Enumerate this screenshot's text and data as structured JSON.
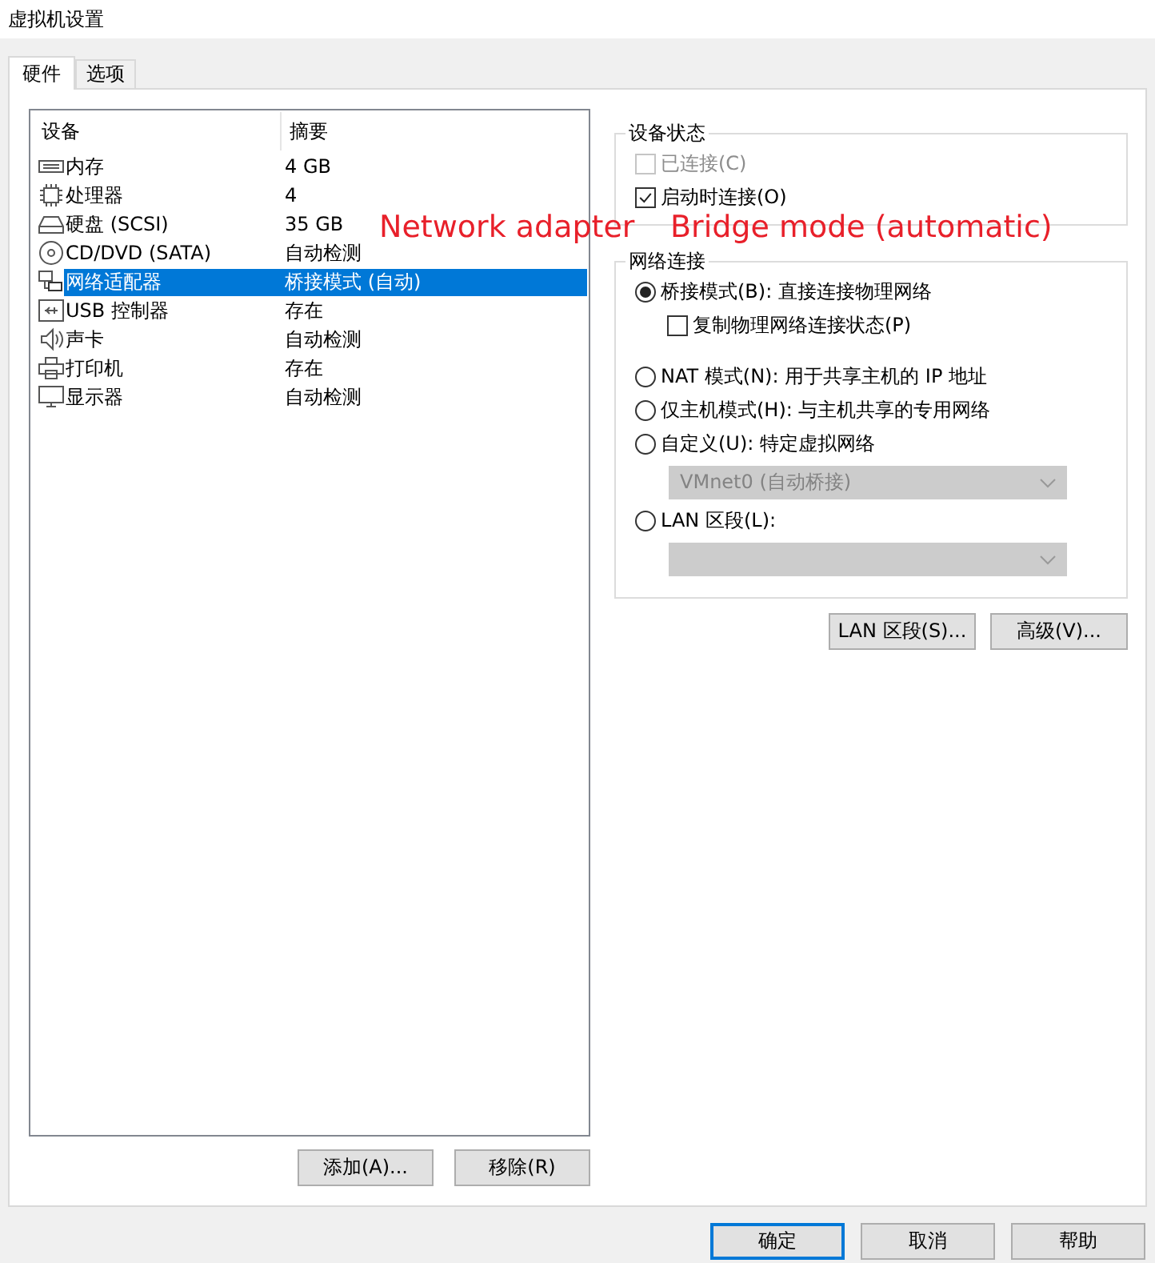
{
  "window": {
    "title": "虚拟机设置"
  },
  "tabs": [
    {
      "label": "硬件",
      "selected": true
    },
    {
      "label": "选项",
      "selected": false
    }
  ],
  "device_list": {
    "columns": [
      "设备",
      "摘要"
    ],
    "rows": [
      {
        "kind": "memory",
        "device": "内存",
        "summary": "4 GB",
        "selected": false
      },
      {
        "kind": "cpu",
        "device": "处理器",
        "summary": "4",
        "selected": false
      },
      {
        "kind": "disk",
        "device": "硬盘 (SCSI)",
        "summary": "35 GB",
        "selected": false
      },
      {
        "kind": "cd",
        "device": "CD/DVD (SATA)",
        "summary": "自动检测",
        "selected": false
      },
      {
        "kind": "network",
        "device": "网络适配器",
        "summary": "桥接模式 (自动)",
        "selected": true
      },
      {
        "kind": "usb",
        "device": "USB 控制器",
        "summary": "存在",
        "selected": false
      },
      {
        "kind": "sound",
        "device": "声卡",
        "summary": "自动检测",
        "selected": false
      },
      {
        "kind": "printer",
        "device": "打印机",
        "summary": "存在",
        "selected": false
      },
      {
        "kind": "display",
        "device": "显示器",
        "summary": "自动检测",
        "selected": false
      }
    ]
  },
  "list_buttons": [
    "添加(A)...",
    "移除(R)"
  ],
  "device_status": {
    "title": "设备状态",
    "options": [
      {
        "label": "已连接(C)",
        "checked": false,
        "disabled": true
      },
      {
        "label": "启动时连接(O)",
        "checked": true,
        "disabled": false
      }
    ]
  },
  "network_connection": {
    "title": "网络连接",
    "items": [
      {
        "kind": "radio",
        "label": "桥接模式(B): 直接连接物理网络",
        "selected": true
      },
      {
        "kind": "checkbox",
        "label": "复制物理网络连接状态(P)",
        "checked": false
      },
      {
        "kind": "radio",
        "label": "NAT 模式(N): 用于共享主机的 IP 地址",
        "selected": false
      },
      {
        "kind": "radio",
        "label": "仅主机模式(H): 与主机共享的专用网络",
        "selected": false
      },
      {
        "kind": "radio",
        "label": "自定义(U): 特定虚拟网络",
        "selected": false
      },
      {
        "kind": "dropdown",
        "value": "VMnet0 (自动桥接)",
        "disabled": true
      },
      {
        "kind": "radio",
        "label": "LAN 区段(L):",
        "selected": false
      },
      {
        "kind": "dropdown",
        "disabled": true
      }
    ]
  },
  "network_buttons": [
    "LAN 区段(S)...",
    "高级(V)..."
  ],
  "dialog_buttons": [
    {
      "label": "确定",
      "default": true
    },
    {
      "label": "取消",
      "default": false
    },
    {
      "label": "帮助",
      "default": false
    }
  ],
  "annotations": [
    "Network adapter",
    "Bridge mode (automatic)"
  ]
}
